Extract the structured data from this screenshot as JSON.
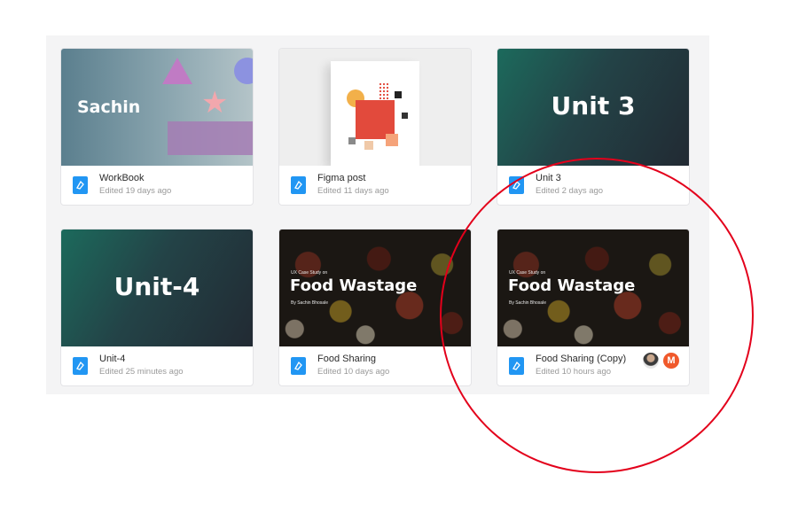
{
  "files": [
    {
      "title": "WorkBook",
      "edited": "Edited 19 days ago",
      "thumb_text": "Sachin"
    },
    {
      "title": "Figma post",
      "edited": "Edited 11 days ago"
    },
    {
      "title": "Unit 3",
      "edited": "Edited 2 days ago",
      "thumb_text": "Unit 3"
    },
    {
      "title": "Unit-4",
      "edited": "Edited 25 minutes ago",
      "thumb_text": "Unit-4"
    },
    {
      "title": "Food Sharing",
      "edited": "Edited 10 days ago",
      "thumb_kicker": "UX Case Study on",
      "thumb_text": "Food Wastage",
      "thumb_byline": "By Sachin Bhosale"
    },
    {
      "title": "Food Sharing (Copy)",
      "edited": "Edited 10 hours ago",
      "thumb_kicker": "UX Case Study on",
      "thumb_text": "Food Wastage",
      "thumb_byline": "By Sachin Bhosale",
      "collaborator_initial": "M"
    }
  ],
  "icons": {
    "file": "figma-file-icon",
    "highlight": "red-circle-annotation"
  },
  "colors": {
    "file_icon": "#2196f3",
    "highlight": "#e3001b",
    "avatar_m": "#f0592b"
  }
}
